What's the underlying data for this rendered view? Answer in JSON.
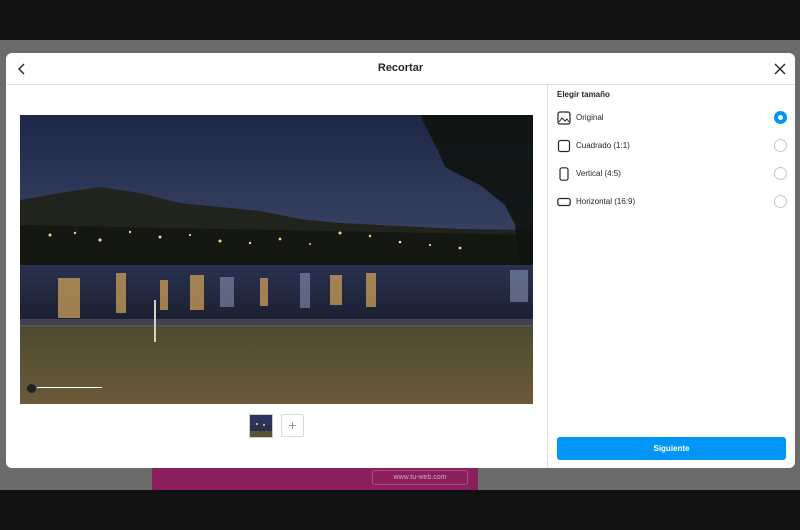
{
  "modal": {
    "title": "Recortar",
    "back_icon": "chevron-left-icon",
    "close_icon": "close-icon"
  },
  "background_banner": {
    "text": "www.tu-web.com"
  },
  "photo": {
    "description_icon": "photo-preview"
  },
  "gallery": {
    "add_icon_text": "+"
  },
  "size_panel": {
    "title": "Elegir tamaño",
    "options": [
      {
        "label": "Original",
        "icon": "image-icon",
        "selected": true
      },
      {
        "label": "Cuadrado (1:1)",
        "icon": "square-icon",
        "selected": false
      },
      {
        "label": "Vertical (4:5)",
        "icon": "portrait-icon",
        "selected": false
      },
      {
        "label": "Horizontal (16:9)",
        "icon": "landscape-icon",
        "selected": false
      }
    ]
  },
  "footer": {
    "next_label": "Siguiente"
  },
  "colors": {
    "accent": "#0095f6",
    "overlay": "#6b6b6b",
    "banner": "#8a1f5c"
  }
}
